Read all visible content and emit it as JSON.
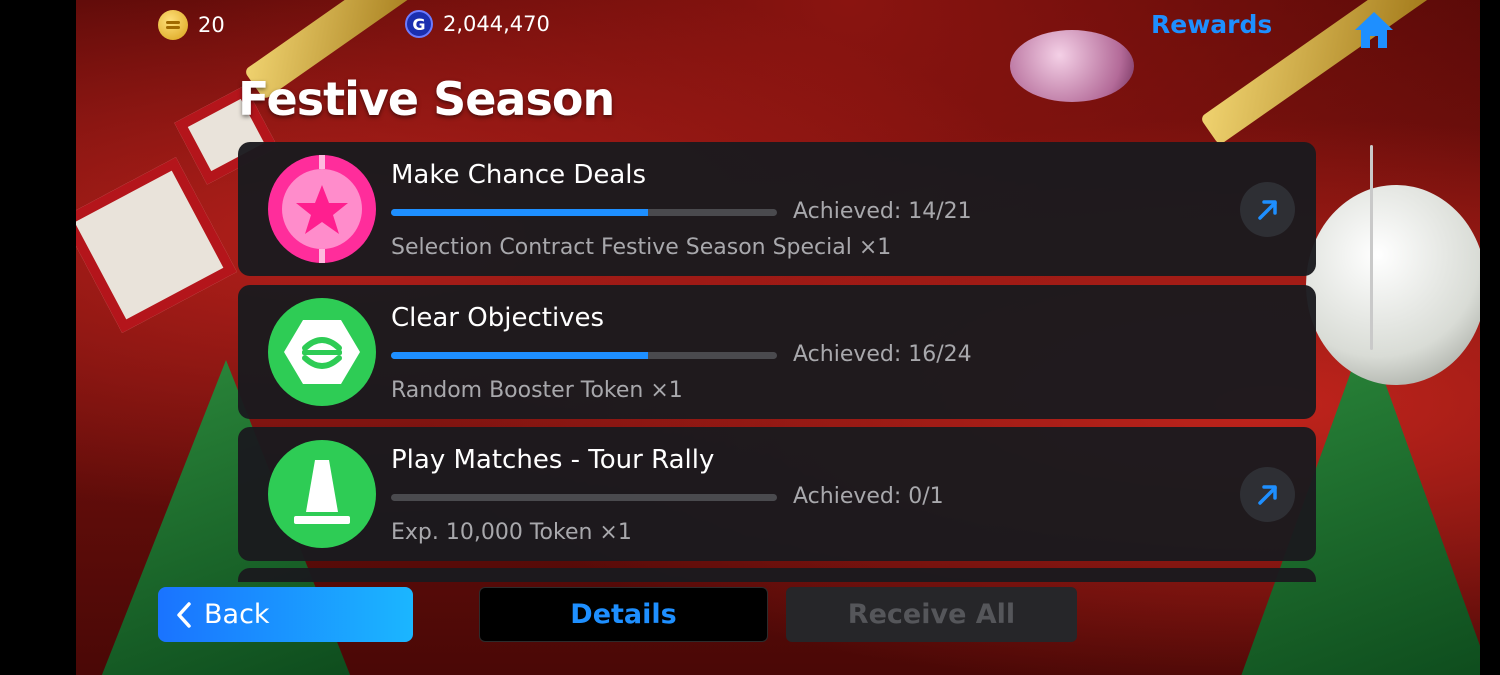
{
  "header": {
    "coins": "20",
    "gp_symbol": "G",
    "gp": "2,044,470",
    "rewards_label": "Rewards"
  },
  "page_title": "Festive Season",
  "missions": [
    {
      "title": "Make Chance Deals",
      "achieved": "Achieved: 14/21",
      "progress": 0.667,
      "reward": "Selection Contract Festive Season Special ×1",
      "icon": "star-icon",
      "icon_color": "#ff2d9b",
      "has_link": true
    },
    {
      "title": "Clear Objectives",
      "achieved": "Achieved: 16/24",
      "progress": 0.667,
      "reward": "Random Booster Token ×1",
      "icon": "hexagon-objective-icon",
      "icon_color": "#2ecc55",
      "has_link": false
    },
    {
      "title": "Play Matches - Tour Rally",
      "achieved": "Achieved: 0/1",
      "progress": 0,
      "reward": "Exp. 10,000 Token ×1",
      "icon": "cone-icon",
      "icon_color": "#2ecc55",
      "has_link": true
    }
  ],
  "footer": {
    "back_label": "Back",
    "details_label": "Details",
    "receive_all_label": "Receive All"
  },
  "colors": {
    "accent": "#1e8fff",
    "card_bg": "#1a1a1e"
  }
}
